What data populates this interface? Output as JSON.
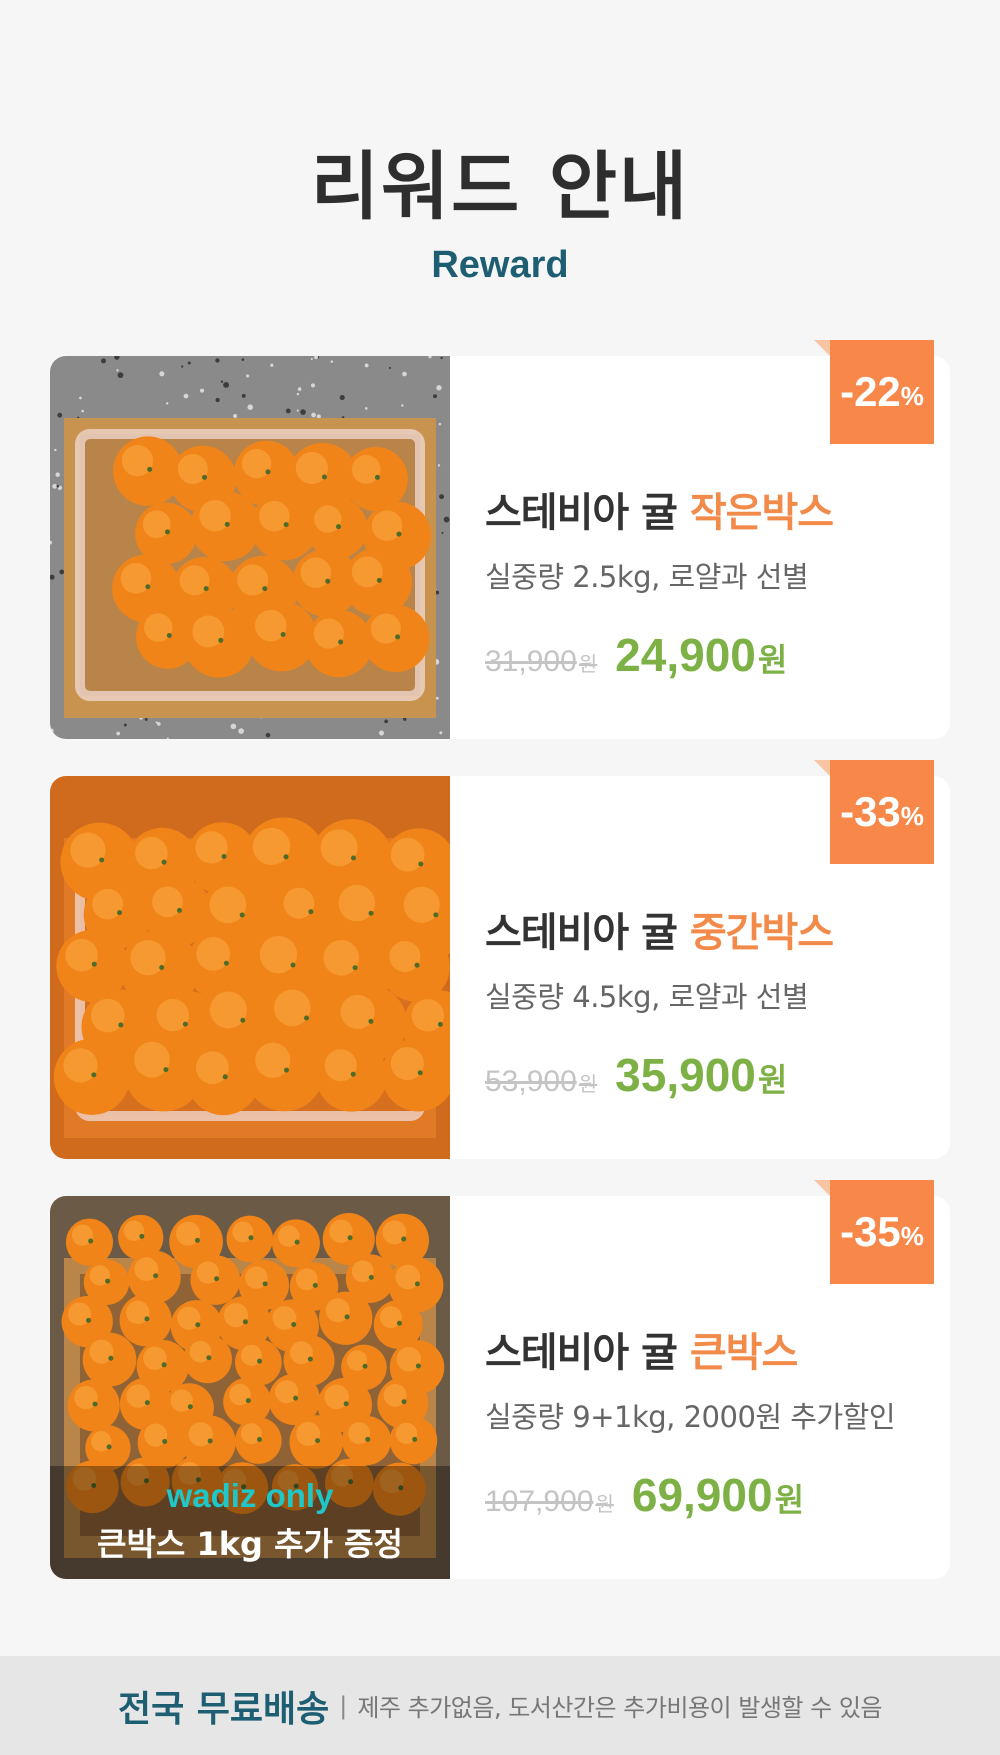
{
  "header": {
    "title": "리워드 안내",
    "subtitle": "Reward"
  },
  "colors": {
    "accent": "#f7884a",
    "price": "#7db146",
    "brand": "#1e5e72",
    "wadiz": "#1fc7c9"
  },
  "rewards": [
    {
      "badge_num": "-22",
      "badge_pct": "%",
      "name_prefix": "스테비아 귤 ",
      "name_highlight": "작은박스",
      "desc": "실중량 2.5kg, 로얄과 선별",
      "old_price": "31,900",
      "old_unit": "원",
      "new_price": "24,900",
      "new_unit": "원",
      "image_icon": "tangerine-box-photo"
    },
    {
      "badge_num": "-33",
      "badge_pct": "%",
      "name_prefix": "스테비아 귤 ",
      "name_highlight": "중간박스",
      "desc": "실중량 4.5kg, 로얄과 선별",
      "old_price": "53,900",
      "old_unit": "원",
      "new_price": "35,900",
      "new_unit": "원",
      "image_icon": "tangerine-box-photo"
    },
    {
      "badge_num": "-35",
      "badge_pct": "%",
      "name_prefix": "스테비아 귤 ",
      "name_highlight": "큰박스",
      "desc": "실중량 9+1kg, 2000원 추가할인",
      "old_price": "107,900",
      "old_unit": "원",
      "new_price": "69,900",
      "new_unit": "원",
      "image_icon": "tangerine-box-photo",
      "overlay_brand": "wadiz only",
      "overlay_text": "큰박스 1kg 추가 증정"
    }
  ],
  "footer": {
    "main": "전국 무료배송",
    "separator": "|",
    "note": "제주 추가없음, 도서산간은 추가비용이 발생할 수 있음"
  }
}
